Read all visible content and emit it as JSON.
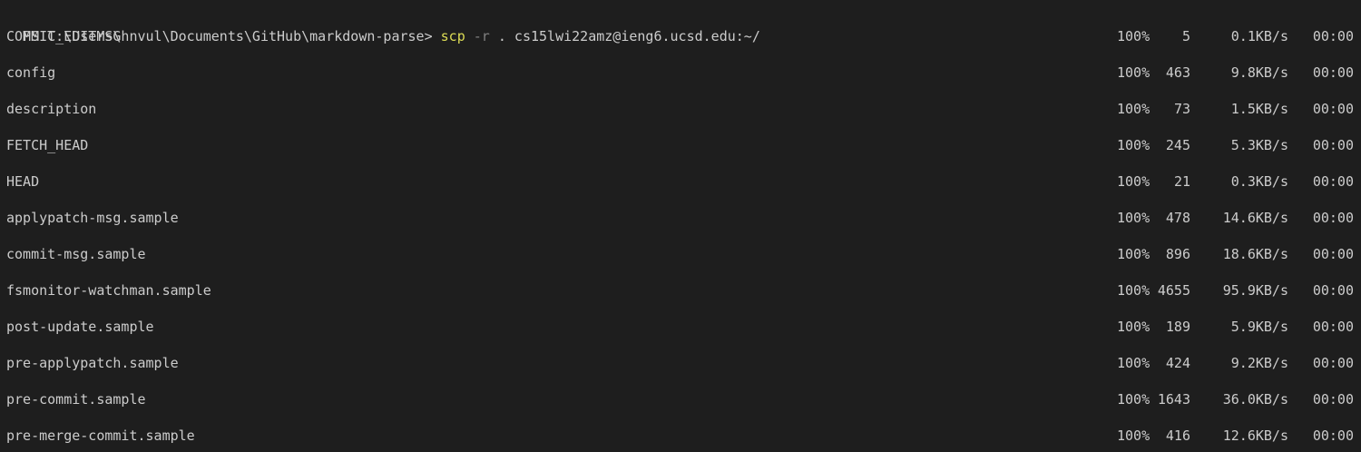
{
  "terminal": {
    "prompt": "PS C:\\Users\\hnvul\\Documents\\GitHub\\markdown-parse> ",
    "command": "scp",
    "flag": "-r",
    "args": ". cs15lwi22amz@ieng6.ucsd.edu:~/"
  },
  "transfers": [
    {
      "file": "COMMIT_EDITMSG",
      "percent": "100%",
      "size": "5",
      "rate": "0.1KB/s",
      "time": "00:00"
    },
    {
      "file": "config",
      "percent": "100%",
      "size": "463",
      "rate": "9.8KB/s",
      "time": "00:00"
    },
    {
      "file": "description",
      "percent": "100%",
      "size": "73",
      "rate": "1.5KB/s",
      "time": "00:00"
    },
    {
      "file": "FETCH_HEAD",
      "percent": "100%",
      "size": "245",
      "rate": "5.3KB/s",
      "time": "00:00"
    },
    {
      "file": "HEAD",
      "percent": "100%",
      "size": "21",
      "rate": "0.3KB/s",
      "time": "00:00"
    },
    {
      "file": "applypatch-msg.sample",
      "percent": "100%",
      "size": "478",
      "rate": "14.6KB/s",
      "time": "00:00"
    },
    {
      "file": "commit-msg.sample",
      "percent": "100%",
      "size": "896",
      "rate": "18.6KB/s",
      "time": "00:00"
    },
    {
      "file": "fsmonitor-watchman.sample",
      "percent": "100%",
      "size": "4655",
      "rate": "95.9KB/s",
      "time": "00:00"
    },
    {
      "file": "post-update.sample",
      "percent": "100%",
      "size": "189",
      "rate": "5.9KB/s",
      "time": "00:00"
    },
    {
      "file": "pre-applypatch.sample",
      "percent": "100%",
      "size": "424",
      "rate": "9.2KB/s",
      "time": "00:00"
    },
    {
      "file": "pre-commit.sample",
      "percent": "100%",
      "size": "1643",
      "rate": "36.0KB/s",
      "time": "00:00"
    },
    {
      "file": "pre-merge-commit.sample",
      "percent": "100%",
      "size": "416",
      "rate": "12.6KB/s",
      "time": "00:00"
    }
  ]
}
